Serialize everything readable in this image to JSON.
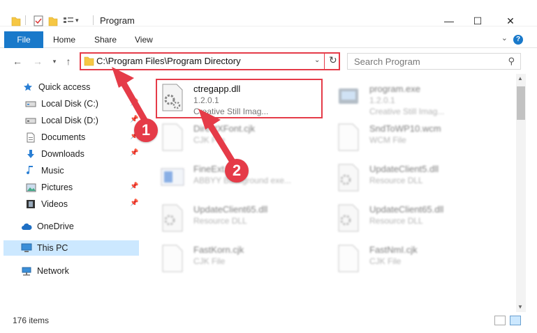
{
  "window": {
    "title": "Program",
    "minimize": "—",
    "maximize": "☐",
    "close": "✕"
  },
  "ribbon": {
    "tabs": [
      "File",
      "Home",
      "Share",
      "View"
    ],
    "help": "?"
  },
  "address": {
    "path": "C:\\Program Files\\Program Directory",
    "search_placeholder": "Search Program"
  },
  "sidebar": {
    "items": [
      {
        "label": "Quick access",
        "icon": "star-icon"
      },
      {
        "label": "Local Disk (C:)",
        "icon": "drive-icon"
      },
      {
        "label": "Local Disk (D:)",
        "icon": "drive-icon"
      },
      {
        "label": "Documents",
        "icon": "documents-icon"
      },
      {
        "label": "Downloads",
        "icon": "download-icon"
      },
      {
        "label": "Music",
        "icon": "music-icon"
      },
      {
        "label": "Pictures",
        "icon": "pictures-icon"
      },
      {
        "label": "Videos",
        "icon": "videos-icon"
      },
      {
        "label": "OneDrive",
        "icon": "cloud-icon"
      },
      {
        "label": "This PC",
        "icon": "computer-icon"
      },
      {
        "label": "Network",
        "icon": "network-icon"
      }
    ]
  },
  "files": [
    {
      "name": "ctregapp.dll",
      "line1": "1.2.0.1",
      "line2": "Creative Still Imag..."
    },
    {
      "name": "program.exe",
      "line1": "1.2.0.1",
      "line2": "Creative Still Imag..."
    },
    {
      "name": "DirectXFont.cjk",
      "line1": "CJK File",
      "line2": ""
    },
    {
      "name": "SndToWP10.wcm",
      "line1": "WCM File",
      "line2": ""
    },
    {
      "name": "FineExt.dll",
      "line1": "ABBYY Background exe...",
      "line2": ""
    },
    {
      "name": "UpdateClient5.dll",
      "line1": "Resource DLL",
      "line2": ""
    },
    {
      "name": "UpdateClient65.dll",
      "line1": "Resource DLL",
      "line2": ""
    },
    {
      "name": "UpdateClient65.dll",
      "line1": "Resource DLL",
      "line2": ""
    },
    {
      "name": "FastKorn.cjk",
      "line1": "CJK File",
      "line2": ""
    },
    {
      "name": "FastNmI.cjk",
      "line1": "CJK File",
      "line2": ""
    }
  ],
  "status": {
    "item_count": "176 items"
  },
  "callouts": [
    "1",
    "2"
  ],
  "colors": {
    "accent": "#1979ca",
    "highlight": "#e53b48",
    "selected": "#cce8ff",
    "folder": "#f6c744"
  }
}
